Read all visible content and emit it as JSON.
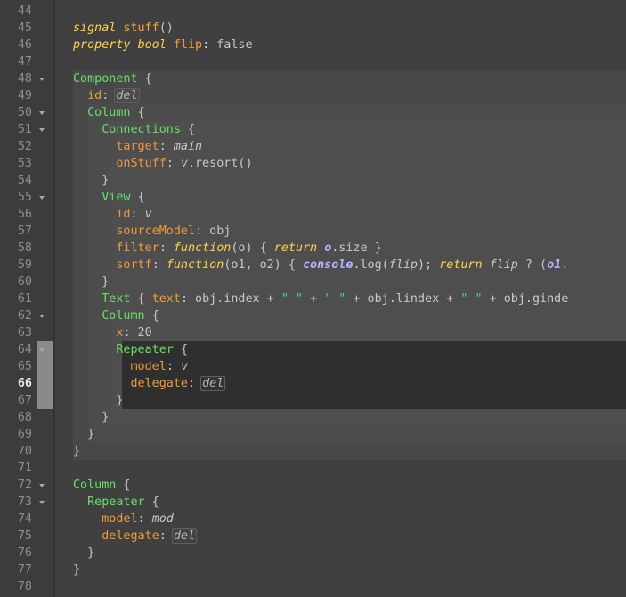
{
  "editor": {
    "current_line": 66,
    "gutter_lines": [
      {
        "n": "44",
        "fold": false
      },
      {
        "n": "45",
        "fold": false
      },
      {
        "n": "46",
        "fold": false
      },
      {
        "n": "47",
        "fold": false
      },
      {
        "n": "48",
        "fold": true
      },
      {
        "n": "49",
        "fold": false
      },
      {
        "n": "50",
        "fold": true
      },
      {
        "n": "51",
        "fold": true
      },
      {
        "n": "52",
        "fold": false
      },
      {
        "n": "53",
        "fold": false
      },
      {
        "n": "54",
        "fold": false
      },
      {
        "n": "55",
        "fold": true
      },
      {
        "n": "56",
        "fold": false
      },
      {
        "n": "57",
        "fold": false
      },
      {
        "n": "58",
        "fold": false
      },
      {
        "n": "59",
        "fold": false
      },
      {
        "n": "60",
        "fold": false
      },
      {
        "n": "61",
        "fold": false
      },
      {
        "n": "62",
        "fold": true
      },
      {
        "n": "63",
        "fold": false
      },
      {
        "n": "64",
        "fold": true
      },
      {
        "n": "65",
        "fold": false
      },
      {
        "n": "66",
        "fold": false
      },
      {
        "n": "67",
        "fold": false
      },
      {
        "n": "68",
        "fold": false
      },
      {
        "n": "69",
        "fold": false
      },
      {
        "n": "70",
        "fold": false
      },
      {
        "n": "71",
        "fold": false
      },
      {
        "n": "72",
        "fold": true
      },
      {
        "n": "73",
        "fold": true
      },
      {
        "n": "74",
        "fold": false
      },
      {
        "n": "75",
        "fold": false
      },
      {
        "n": "76",
        "fold": false
      },
      {
        "n": "77",
        "fold": false
      },
      {
        "n": "78",
        "fold": false
      }
    ],
    "code_lines": [
      [],
      [
        [
          "kw",
          "signal"
        ],
        [
          "plain",
          " "
        ],
        [
          "fn",
          "stuff"
        ],
        [
          "plain",
          "()"
        ]
      ],
      [
        [
          "kw",
          "property"
        ],
        [
          "plain",
          " "
        ],
        [
          "kw",
          "bool"
        ],
        [
          "plain",
          " "
        ],
        [
          "pr",
          "flip"
        ],
        [
          "plain",
          ": false"
        ]
      ],
      [],
      [
        [
          "ty",
          "Component"
        ],
        [
          "plain",
          " {"
        ]
      ],
      [
        [
          "plain",
          "  "
        ],
        [
          "pr",
          "id"
        ],
        [
          "plain",
          ": "
        ],
        [
          "boxed",
          "del"
        ]
      ],
      [
        [
          "plain",
          "  "
        ],
        [
          "ty",
          "Column"
        ],
        [
          "plain",
          " {"
        ]
      ],
      [
        [
          "plain",
          "    "
        ],
        [
          "ty",
          "Connections"
        ],
        [
          "plain",
          " {"
        ]
      ],
      [
        [
          "plain",
          "      "
        ],
        [
          "pr",
          "target"
        ],
        [
          "plain",
          ": "
        ],
        [
          "it",
          "main"
        ]
      ],
      [
        [
          "plain",
          "      "
        ],
        [
          "pr",
          "onStuff"
        ],
        [
          "plain",
          ": "
        ],
        [
          "it",
          "v"
        ],
        [
          "plain",
          ".resort()"
        ]
      ],
      [
        [
          "plain",
          "    }"
        ]
      ],
      [
        [
          "plain",
          "    "
        ],
        [
          "ty",
          "View"
        ],
        [
          "plain",
          " {"
        ]
      ],
      [
        [
          "plain",
          "      "
        ],
        [
          "pr",
          "id"
        ],
        [
          "plain",
          ": "
        ],
        [
          "it",
          "v"
        ]
      ],
      [
        [
          "plain",
          "      "
        ],
        [
          "pr",
          "sourceModel"
        ],
        [
          "plain",
          ": obj"
        ]
      ],
      [
        [
          "plain",
          "      "
        ],
        [
          "pr",
          "filter"
        ],
        [
          "plain",
          ": "
        ],
        [
          "kw",
          "function"
        ],
        [
          "plain",
          "(o) { "
        ],
        [
          "kw",
          "return"
        ],
        [
          "plain",
          " "
        ],
        [
          "cv",
          "o"
        ],
        [
          "plain",
          ".size }"
        ]
      ],
      [
        [
          "plain",
          "      "
        ],
        [
          "pr",
          "sortf"
        ],
        [
          "plain",
          ": "
        ],
        [
          "kw",
          "function"
        ],
        [
          "plain",
          "(o1, o2) { "
        ],
        [
          "cv",
          "console"
        ],
        [
          "plain",
          ".log("
        ],
        [
          "it",
          "flip"
        ],
        [
          "plain",
          "); "
        ],
        [
          "kw",
          "return"
        ],
        [
          "plain",
          " "
        ],
        [
          "it",
          "flip"
        ],
        [
          "plain",
          " ? ("
        ],
        [
          "cv",
          "o1"
        ],
        [
          "plain",
          "."
        ]
      ],
      [
        [
          "plain",
          "    }"
        ]
      ],
      [
        [
          "plain",
          "    "
        ],
        [
          "ty",
          "Text"
        ],
        [
          "plain",
          " { "
        ],
        [
          "pr",
          "text"
        ],
        [
          "plain",
          ": obj.index + "
        ],
        [
          "str",
          "\" \""
        ],
        [
          "plain",
          " + "
        ],
        [
          "str",
          "\" \""
        ],
        [
          "plain",
          " + obj.lindex + "
        ],
        [
          "str",
          "\" \""
        ],
        [
          "plain",
          " + obj.ginde"
        ]
      ],
      [
        [
          "plain",
          "    "
        ],
        [
          "ty",
          "Column"
        ],
        [
          "plain",
          " {"
        ]
      ],
      [
        [
          "plain",
          "      "
        ],
        [
          "pr",
          "x"
        ],
        [
          "plain",
          ": 20"
        ]
      ],
      [
        [
          "plain",
          "      "
        ],
        [
          "ty",
          "Repeater"
        ],
        [
          "plain",
          " {"
        ]
      ],
      [
        [
          "plain",
          "        "
        ],
        [
          "pr",
          "model"
        ],
        [
          "plain",
          ": "
        ],
        [
          "it",
          "v"
        ]
      ],
      [
        [
          "plain",
          "        "
        ],
        [
          "pr",
          "delegate"
        ],
        [
          "plain",
          ": "
        ],
        [
          "boxed",
          "del"
        ]
      ],
      [
        [
          "plain",
          "      }"
        ]
      ],
      [
        [
          "plain",
          "    }"
        ]
      ],
      [
        [
          "plain",
          "  }"
        ]
      ],
      [
        [
          "plain",
          "}"
        ]
      ],
      [],
      [
        [
          "ty",
          "Column"
        ],
        [
          "plain",
          " {"
        ]
      ],
      [
        [
          "plain",
          "  "
        ],
        [
          "ty",
          "Repeater"
        ],
        [
          "plain",
          " {"
        ]
      ],
      [
        [
          "plain",
          "    "
        ],
        [
          "pr",
          "model"
        ],
        [
          "plain",
          ": "
        ],
        [
          "it",
          "mod"
        ]
      ],
      [
        [
          "plain",
          "    "
        ],
        [
          "pr",
          "delegate"
        ],
        [
          "plain",
          ": "
        ],
        [
          "boxed",
          "del"
        ]
      ],
      [
        [
          "plain",
          "  }"
        ]
      ],
      [
        [
          "plain",
          "}"
        ]
      ],
      []
    ]
  }
}
